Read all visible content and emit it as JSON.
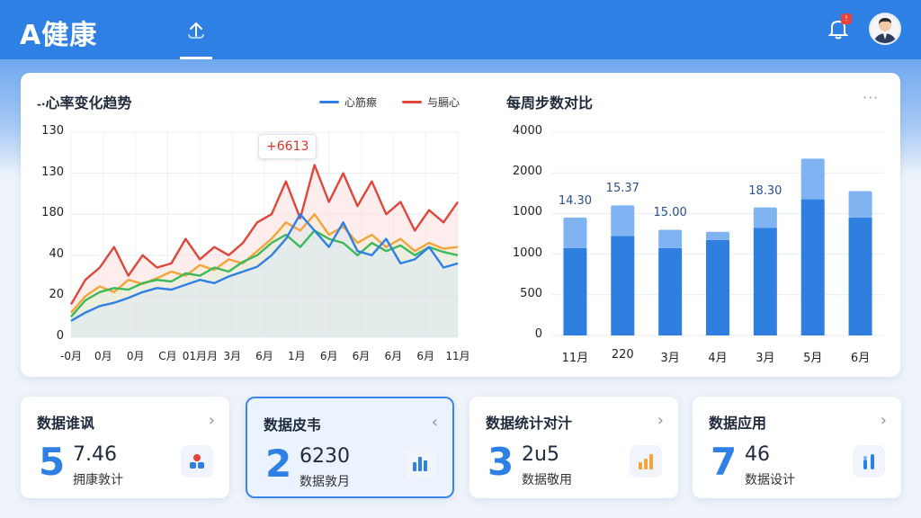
{
  "app": {
    "title": "A健康"
  },
  "header": {
    "notification_badge": "!"
  },
  "line_chart": {
    "title": "心率变化趋势",
    "title_prefix": "-·",
    "legend": [
      {
        "label": "心筋瘵",
        "color": "#2f80e4"
      },
      {
        "label": "与膈心",
        "color": "#e0453a"
      }
    ],
    "tooltip": "+6613"
  },
  "bar_chart": {
    "title": "每周步数对比",
    "more_label": "···"
  },
  "chart_data": [
    {
      "type": "line",
      "title": "心率变化趋势",
      "y_tick_labels": [
        "130",
        "130",
        "180",
        "40",
        "20",
        "0"
      ],
      "x_tick_labels": [
        "-0月",
        "0月",
        "0月",
        "C月",
        "01月月",
        "3月",
        "6月",
        "1月",
        "6月",
        "6月",
        "6月",
        "6月",
        "11月"
      ],
      "ylim": [
        0,
        250
      ],
      "grid": true,
      "legend_position": "top-right",
      "series": [
        {
          "name": "心筋瘵",
          "color": "#2f80e4",
          "values": [
            20,
            30,
            38,
            42,
            48,
            55,
            60,
            58,
            64,
            70,
            66,
            74,
            80,
            86,
            100,
            120,
            150,
            130,
            110,
            140,
            105,
            100,
            120,
            90,
            95,
            110,
            85,
            90
          ]
        },
        {
          "name": "与膈心",
          "color": "#e0453a",
          "values": [
            40,
            70,
            85,
            110,
            75,
            100,
            85,
            90,
            120,
            95,
            110,
            100,
            115,
            140,
            150,
            190,
            145,
            210,
            165,
            200,
            160,
            190,
            150,
            165,
            130,
            155,
            140,
            165
          ]
        },
        {
          "name": "",
          "color": "#f2a53a",
          "values": [
            30,
            50,
            62,
            55,
            70,
            65,
            72,
            80,
            75,
            88,
            82,
            95,
            90,
            105,
            120,
            140,
            130,
            150,
            125,
            135,
            115,
            125,
            110,
            120,
            105,
            115,
            108,
            110
          ]
        },
        {
          "name": "",
          "color": "#3cb95a",
          "values": [
            25,
            45,
            55,
            60,
            58,
            66,
            70,
            68,
            78,
            75,
            85,
            80,
            92,
            100,
            115,
            125,
            110,
            130,
            120,
            115,
            100,
            115,
            105,
            112,
            100,
            110,
            104,
            100
          ]
        }
      ]
    },
    {
      "type": "bar",
      "title": "每周步数对比",
      "categories": [
        "11月",
        "220",
        "3月",
        "4月",
        "3月",
        "5月",
        "6月"
      ],
      "y_tick_labels": [
        "4000",
        "2000",
        "1000",
        "1000",
        "500",
        "0"
      ],
      "ylim": [
        0,
        5
      ],
      "data_labels": [
        "14.30",
        "15.37",
        "15.00",
        "",
        "18.30",
        "",
        ""
      ],
      "series": [
        {
          "name": "",
          "color": "#2e7fe0",
          "values": [
            2.15,
            2.45,
            2.15,
            2.35,
            2.65,
            3.35,
            2.9
          ]
        },
        {
          "name": "",
          "color": "#7fb3f2",
          "values": [
            0.75,
            0.75,
            0.45,
            0.2,
            0.5,
            1.0,
            0.65
          ]
        }
      ]
    }
  ],
  "stats": [
    {
      "title": "数据谁讽",
      "big": "5",
      "value": "7.46",
      "sub": "拥康敦计",
      "icon": "pie-icon",
      "chevron": "›",
      "active": false
    },
    {
      "title": "数据皮韦",
      "big": "2",
      "value": "6230",
      "sub": "数据敦月",
      "icon": "bar-icon",
      "chevron": "‹",
      "active": true
    },
    {
      "title": "数据统计对汁",
      "big": "3",
      "value": "2u5",
      "sub": "数据敬用",
      "icon": "orange-bar-icon",
      "chevron": "›",
      "active": false
    },
    {
      "title": "数据应用",
      "big": "7",
      "value": "46",
      "sub": "数据设计",
      "icon": "column-icon",
      "chevron": "›",
      "active": false
    }
  ]
}
